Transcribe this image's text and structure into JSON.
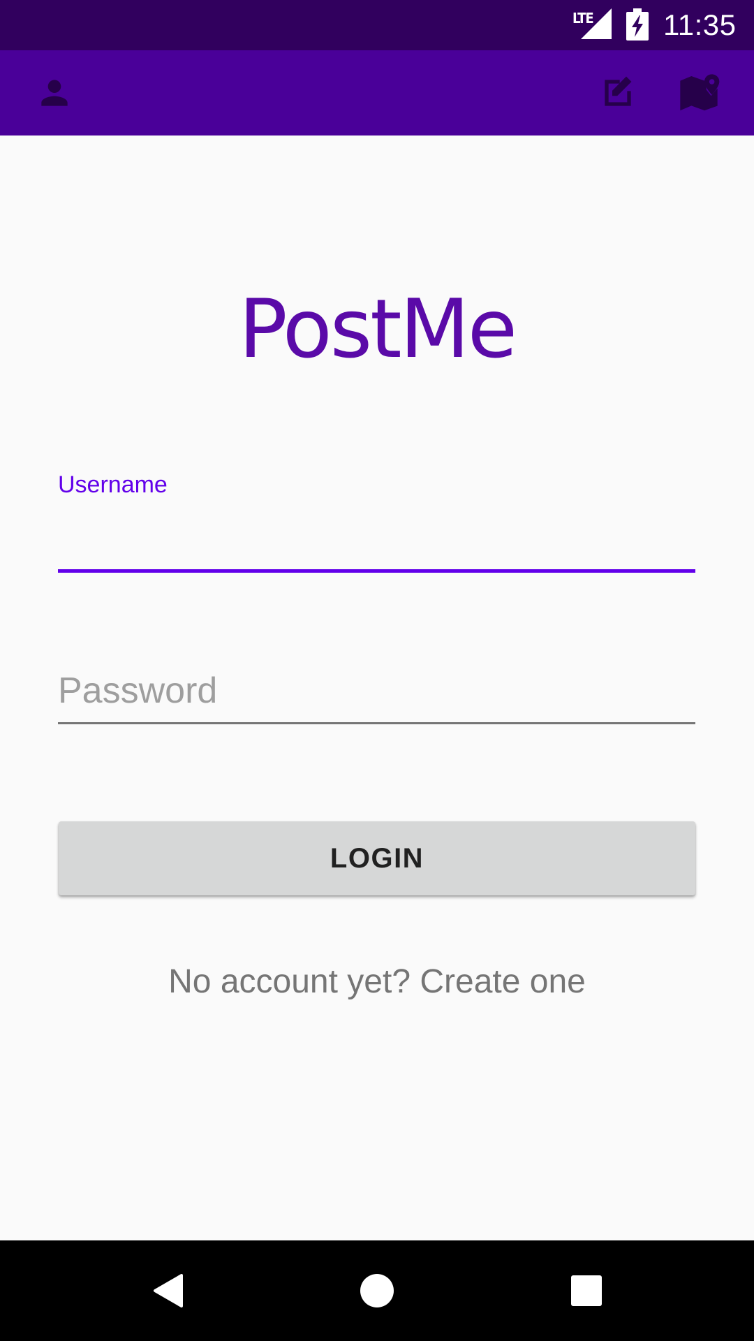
{
  "status_bar": {
    "network": "LTE",
    "time": "11:35",
    "icons": [
      "signal-icon",
      "battery-charging-icon"
    ]
  },
  "app_bar": {
    "background": "#4a0099",
    "icons": [
      "person-icon",
      "edit-icon",
      "map-icon"
    ]
  },
  "logo": {
    "text": "PostMe",
    "color": "#5a0aa8"
  },
  "form": {
    "username": {
      "label": "Username",
      "value": "",
      "focused": true,
      "accent": "#6200ea"
    },
    "password": {
      "placeholder": "Password",
      "value": ""
    },
    "login_label": "LOGIN",
    "create_account_text": "No account yet? Create one"
  },
  "nav_bar": {
    "icons": [
      "back-icon",
      "home-icon",
      "recents-icon"
    ]
  }
}
